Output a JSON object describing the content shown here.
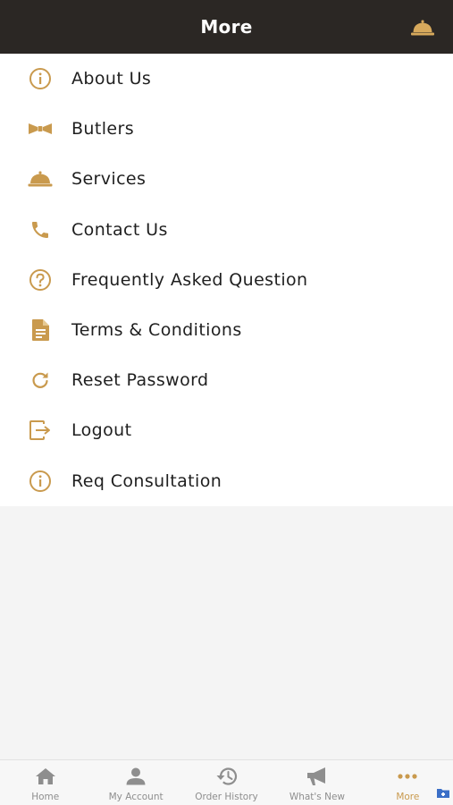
{
  "header": {
    "title": "More",
    "bell_icon": "service-bell-icon"
  },
  "colors": {
    "accent": "#c99a4e",
    "header_bg": "#2b2724",
    "tab_inactive": "#8e8e8e"
  },
  "menu": {
    "items": [
      {
        "label": "About Us",
        "icon": "info-icon"
      },
      {
        "label": "Butlers",
        "icon": "bow-tie-icon"
      },
      {
        "label": "Services",
        "icon": "service-bell-icon"
      },
      {
        "label": "Contact Us",
        "icon": "phone-icon"
      },
      {
        "label": "Frequently Asked Question",
        "icon": "question-icon"
      },
      {
        "label": "Terms & Conditions",
        "icon": "document-icon"
      },
      {
        "label": "Reset Password",
        "icon": "refresh-icon"
      },
      {
        "label": "Logout",
        "icon": "logout-icon"
      },
      {
        "label": "Req Consultation",
        "icon": "info-icon"
      }
    ]
  },
  "tabbar": {
    "tabs": [
      {
        "label": "Home",
        "icon": "home-icon",
        "active": false
      },
      {
        "label": "My Account",
        "icon": "person-icon",
        "active": false
      },
      {
        "label": "Order History",
        "icon": "history-icon",
        "active": false
      },
      {
        "label": "What's New",
        "icon": "megaphone-icon",
        "active": false
      },
      {
        "label": "More",
        "icon": "more-dots-icon",
        "active": true
      }
    ]
  }
}
